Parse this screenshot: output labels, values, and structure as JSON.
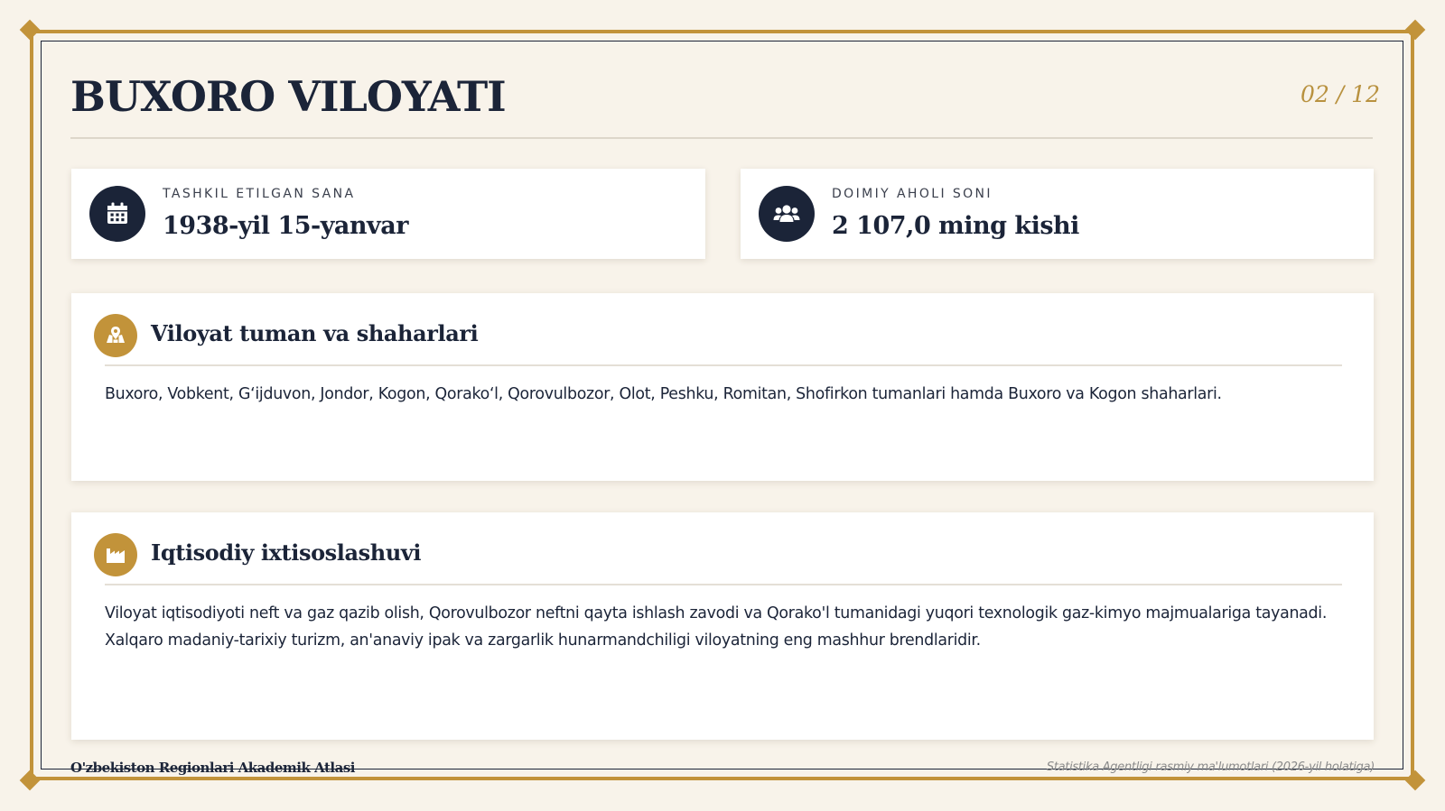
{
  "header": {
    "title": "BUXORO VILOYATI",
    "page_number": "02 / 12"
  },
  "stats": [
    {
      "icon": "calendar-icon",
      "label": "TASHKIL ETILGAN SANA",
      "value": "1938-yil 15-yanvar"
    },
    {
      "icon": "users-icon",
      "label": "DOIMIY AHOLI SONI",
      "value": "2 107,0 ming kishi"
    }
  ],
  "sections": [
    {
      "icon": "map-marker-icon",
      "title": "Viloyat tuman va shaharlari",
      "body": "Buxoro, Vobkent, G‘ijduvon, Jondor, Kogon, Qorako‘l, Qorovulbozor, Olot, Peshku, Romitan, Shofirkon tumanlari hamda Buxoro va Kogon shaharlari."
    },
    {
      "icon": "industry-icon",
      "title": "Iqtisodiy ixtisoslashuvi",
      "body": "Viloyat iqtisodiyoti neft va gaz qazib olish, Qorovulbozor neftni qayta ishlash zavodi va Qorako'l tumanidagi yuqori texnologik gaz-kimyo majmualariga tayanadi. Xalqaro madaniy-tarixiy turizm, an'anaviy ipak va zargarlik hunarmandchiligi viloyatning eng mashhur brendlaridir."
    }
  ],
  "footer": {
    "left": "O'zbekiston Regionlari Akademik Atlasi",
    "right": "Statistika Agentligi rasmiy ma'lumotlari (2026-yil holatiga)"
  },
  "colors": {
    "navy": "#1b2438",
    "gold": "#c2933a",
    "background": "#f8f3ea"
  }
}
